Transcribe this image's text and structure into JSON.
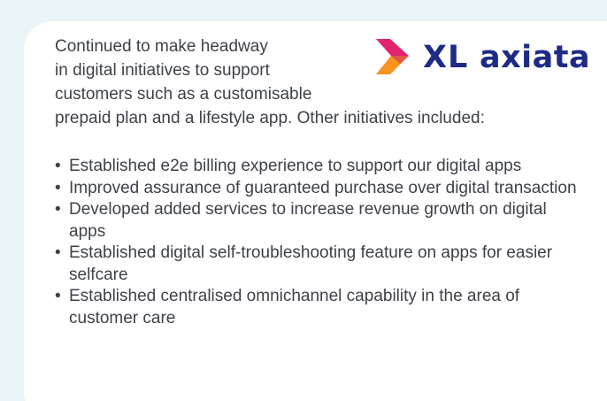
{
  "intro": {
    "line1": "Continued to make headway",
    "line2": "in digital initiatives to support",
    "line3": "customers such as a customisable",
    "line4": "prepaid plan and a lifestyle app. Other initiatives included:"
  },
  "logo": {
    "text": "XL axiata",
    "icon": "xl-axiata-chevron-logo",
    "colors": {
      "text": "#1e2b86",
      "chevron_top": "#e2246f",
      "chevron_bottom": "#f7931e"
    }
  },
  "bullets": [
    {
      "text": "Established e2e billing experience to support our digital apps"
    },
    {
      "text": "Improved assurance of guaranteed purchase over digital transaction"
    },
    {
      "text": "Developed added services to increase revenue growth on digital apps"
    },
    {
      "text": "Established digital self-troubleshooting feature on apps for easier selfcare"
    },
    {
      "text": "Established centralised omnichannel capability in the area of customer care"
    }
  ],
  "bullet_char": "•",
  "colors": {
    "background": "#e9f4f7",
    "card": "#ffffff",
    "body_text": "#3d4249"
  }
}
